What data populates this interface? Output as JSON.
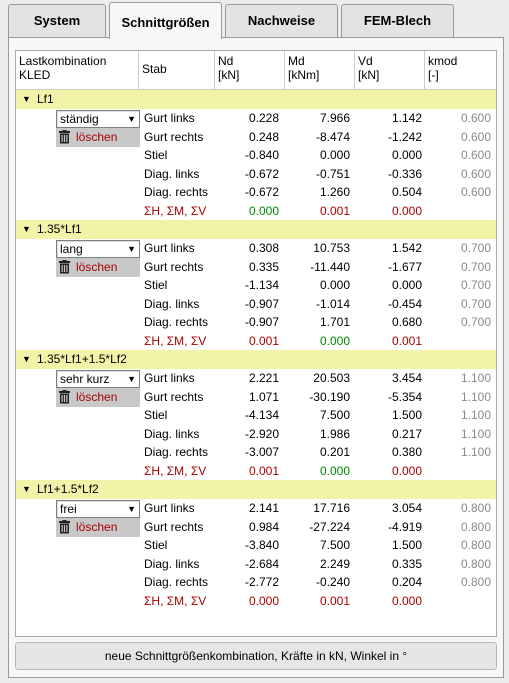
{
  "tabs": [
    {
      "label": "System",
      "active": false
    },
    {
      "label": "Schnittgrößen",
      "active": true
    },
    {
      "label": "Nachweise",
      "active": false
    },
    {
      "label": "FEM-Blech",
      "active": false
    }
  ],
  "columns": {
    "lk_line1": "Lastkombination",
    "lk_line2": "KLED",
    "stab": "Stab",
    "nd_line1": "Nd",
    "nd_line2": "[kN]",
    "md_line1": "Md",
    "md_line2": "[kNm]",
    "vd_line1": "Vd",
    "vd_line2": "[kN]",
    "kmod_line1": "kmod",
    "kmod_line2": "[-]"
  },
  "delete_label": "löschen",
  "groups": [
    {
      "name": "Lf1",
      "kled": "ständig",
      "rows": [
        {
          "stab": "Gurt links",
          "nd": "0.228",
          "md": "7.966",
          "vd": "1.142",
          "kmod": "0.600"
        },
        {
          "stab": "Gurt rechts",
          "nd": "0.248",
          "md": "-8.474",
          "vd": "-1.242",
          "kmod": "0.600"
        },
        {
          "stab": "Stiel",
          "nd": "-0.840",
          "md": "0.000",
          "vd": "0.000",
          "kmod": "0.600"
        },
        {
          "stab": "Diag. links",
          "nd": "-0.672",
          "md": "-0.751",
          "vd": "-0.336",
          "kmod": "0.600"
        },
        {
          "stab": "Diag. rechts",
          "nd": "-0.672",
          "md": "1.260",
          "vd": "0.504",
          "kmod": "0.600"
        }
      ],
      "sum": {
        "label": "ΣH, ΣM, ΣV",
        "h": "0.000",
        "m": "0.001",
        "v": "0.000",
        "h_color": "green",
        "m_color": "red",
        "v_color": "red"
      }
    },
    {
      "name": "1.35*Lf1",
      "kled": "lang",
      "rows": [
        {
          "stab": "Gurt links",
          "nd": "0.308",
          "md": "10.753",
          "vd": "1.542",
          "kmod": "0.700"
        },
        {
          "stab": "Gurt rechts",
          "nd": "0.335",
          "md": "-11.440",
          "vd": "-1.677",
          "kmod": "0.700"
        },
        {
          "stab": "Stiel",
          "nd": "-1.134",
          "md": "0.000",
          "vd": "0.000",
          "kmod": "0.700"
        },
        {
          "stab": "Diag. links",
          "nd": "-0.907",
          "md": "-1.014",
          "vd": "-0.454",
          "kmod": "0.700"
        },
        {
          "stab": "Diag. rechts",
          "nd": "-0.907",
          "md": "1.701",
          "vd": "0.680",
          "kmod": "0.700"
        }
      ],
      "sum": {
        "label": "ΣH, ΣM, ΣV",
        "h": "0.001",
        "m": "0.000",
        "v": "0.001",
        "h_color": "red",
        "m_color": "green",
        "v_color": "red"
      }
    },
    {
      "name": "1.35*Lf1+1.5*Lf2",
      "kled": "sehr kurz",
      "rows": [
        {
          "stab": "Gurt links",
          "nd": "2.221",
          "md": "20.503",
          "vd": "3.454",
          "kmod": "1.100"
        },
        {
          "stab": "Gurt rechts",
          "nd": "1.071",
          "md": "-30.190",
          "vd": "-5.354",
          "kmod": "1.100"
        },
        {
          "stab": "Stiel",
          "nd": "-4.134",
          "md": "7.500",
          "vd": "1.500",
          "kmod": "1.100"
        },
        {
          "stab": "Diag. links",
          "nd": "-2.920",
          "md": "1.986",
          "vd": "0.217",
          "kmod": "1.100"
        },
        {
          "stab": "Diag. rechts",
          "nd": "-3.007",
          "md": "0.201",
          "vd": "0.380",
          "kmod": "1.100"
        }
      ],
      "sum": {
        "label": "ΣH, ΣM, ΣV",
        "h": "0.001",
        "m": "0.000",
        "v": "0.000",
        "h_color": "red",
        "m_color": "green",
        "v_color": "red"
      }
    },
    {
      "name": "Lf1+1.5*Lf2",
      "kled": "frei",
      "rows": [
        {
          "stab": "Gurt links",
          "nd": "2.141",
          "md": "17.716",
          "vd": "3.054",
          "kmod": "0.800"
        },
        {
          "stab": "Gurt rechts",
          "nd": "0.984",
          "md": "-27.224",
          "vd": "-4.919",
          "kmod": "0.800"
        },
        {
          "stab": "Stiel",
          "nd": "-3.840",
          "md": "7.500",
          "vd": "1.500",
          "kmod": "0.800"
        },
        {
          "stab": "Diag. links",
          "nd": "-2.684",
          "md": "2.249",
          "vd": "0.335",
          "kmod": "0.800"
        },
        {
          "stab": "Diag. rechts",
          "nd": "-2.772",
          "md": "-0.240",
          "vd": "0.204",
          "kmod": "0.800"
        }
      ],
      "sum": {
        "label": "ΣH, ΣM, ΣV",
        "h": "0.000",
        "m": "0.001",
        "v": "0.000",
        "h_color": "red",
        "m_color": "red",
        "v_color": "red"
      }
    }
  ],
  "bottom_button": "neue Schnittgrößenkombination, Kräfte in kN, Winkel in °"
}
